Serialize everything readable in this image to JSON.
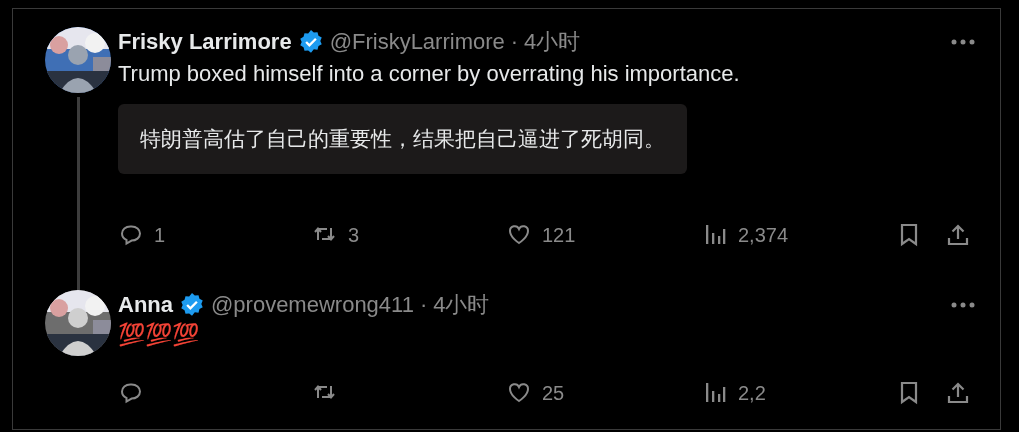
{
  "tweets": [
    {
      "author": "Frisky Larrimore",
      "verified": true,
      "handle": "@FriskyLarrimore",
      "separator": "·",
      "time": "4小时",
      "text": "Trump boxed himself into a corner by overrating his importance.",
      "translation": "特朗普高估了自己的重要性，结果把自己逼进了死胡同。",
      "thread_continues": true,
      "actions": [
        {
          "kind": "reply",
          "count": "1"
        },
        {
          "kind": "repost",
          "count": "3"
        },
        {
          "kind": "like",
          "count": "121"
        },
        {
          "kind": "views",
          "count": "2,374"
        },
        {
          "kind": "bookmark"
        },
        {
          "kind": "share"
        }
      ]
    },
    {
      "author": "Anna",
      "verified": true,
      "handle": "@provemewrong411",
      "separator": "·",
      "time": "4小时",
      "text": "💯💯💯",
      "thread_continues": false,
      "actions": [
        {
          "kind": "reply"
        },
        {
          "kind": "repost"
        },
        {
          "kind": "like",
          "count": "25"
        },
        {
          "kind": "views",
          "count": "2,2"
        },
        {
          "kind": "bookmark"
        },
        {
          "kind": "share"
        }
      ]
    }
  ]
}
